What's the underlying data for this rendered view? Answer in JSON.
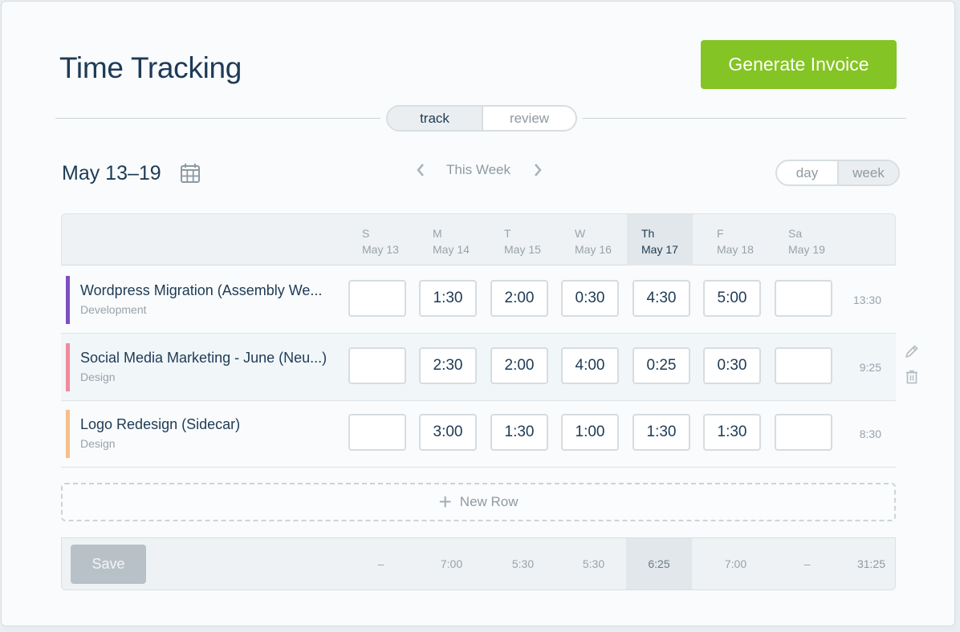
{
  "header": {
    "title": "Time Tracking",
    "generate_invoice_label": "Generate Invoice",
    "accent_color": "#84c424"
  },
  "mode_toggle": {
    "options": [
      {
        "label": "track",
        "active": true
      },
      {
        "label": "review",
        "active": false
      }
    ]
  },
  "week_nav": {
    "range_label": "May 13–19",
    "calendar_icon": "calendar-icon",
    "prev_icon": "chevron-left-icon",
    "current_label": "This Week",
    "next_icon": "chevron-right-icon"
  },
  "range_toggle": {
    "options": [
      {
        "label": "day",
        "active": false
      },
      {
        "label": "week",
        "active": true
      }
    ]
  },
  "days": [
    {
      "abbr": "S",
      "date": "May 13",
      "today": false
    },
    {
      "abbr": "M",
      "date": "May 14",
      "today": false
    },
    {
      "abbr": "T",
      "date": "May 15",
      "today": false
    },
    {
      "abbr": "W",
      "date": "May 16",
      "today": false
    },
    {
      "abbr": "Th",
      "date": "May 17",
      "today": true
    },
    {
      "abbr": "F",
      "date": "May 18",
      "today": false
    },
    {
      "abbr": "Sa",
      "date": "May 19",
      "today": false
    }
  ],
  "rows": [
    {
      "project": "Wordpress Migration (Assembly We...",
      "category": "Development",
      "color": "#7e4fc4",
      "hours": [
        "",
        "1:30",
        "2:00",
        "0:30",
        "4:30",
        "5:00",
        ""
      ],
      "total": "13:30",
      "highlighted": false
    },
    {
      "project": "Social Media Marketing - June (Neu...)",
      "category": "Design",
      "color": "#f08a9c",
      "hours": [
        "",
        "2:30",
        "2:00",
        "4:00",
        "0:25",
        "0:30",
        ""
      ],
      "total": "9:25",
      "highlighted": true,
      "actions": {
        "edit_icon": "pencil-icon",
        "delete_icon": "trash-icon"
      }
    },
    {
      "project": "Logo Redesign (Sidecar)",
      "category": "Design",
      "color": "#f5c089",
      "hours": [
        "",
        "3:00",
        "1:30",
        "1:00",
        "1:30",
        "1:30",
        ""
      ],
      "total": "8:30",
      "highlighted": false
    }
  ],
  "new_row": {
    "icon": "plus-icon",
    "label": "New Row"
  },
  "footer": {
    "save_label": "Save",
    "day_totals": [
      "–",
      "7:00",
      "5:30",
      "5:30",
      "6:25",
      "7:00",
      "–"
    ],
    "grand_total": "31:25"
  }
}
